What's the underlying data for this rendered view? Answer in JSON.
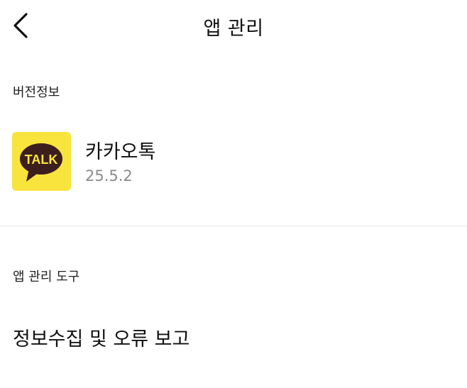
{
  "header": {
    "title": "앱 관리",
    "back_icon": "chevron-left-icon"
  },
  "version_section": {
    "label": "버전정보",
    "app": {
      "name": "카카오톡",
      "version": "25.5.2",
      "icon_text": "TALK",
      "icon_bg": "#F9E43D",
      "bubble_color": "#3C1E1E"
    }
  },
  "tools_section": {
    "label": "앱 관리 도구",
    "items": [
      {
        "label": "정보수집 및 오류 보고"
      }
    ]
  }
}
